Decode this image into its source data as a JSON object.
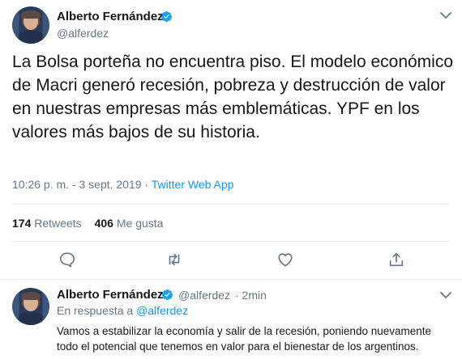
{
  "main_tweet": {
    "author_name": "Alberto Fernández",
    "author_handle": "@alferdez",
    "text": "La Bolsa porteña no encuentra piso. El modelo económico de Macri generó recesión, pobreza y destrucción de valor en nuestras empresas más emblemáticas. YPF en los valores más bajos de su historia.",
    "timestamp": "10:26 p. m. - 3 sept. 2019",
    "separator": " · ",
    "source": "Twitter Web App",
    "retweets_count": "174",
    "retweets_label": "Retweets",
    "likes_count": "406",
    "likes_label": "Me gusta"
  },
  "reply_tweet": {
    "author_name": "Alberto Fernández",
    "author_handle": "@alferdez",
    "time_ago": "· 2min",
    "in_reply_prefix": "En respuesta a",
    "in_reply_handle": "@alferdez",
    "text": "Vamos a estabilizar la economía y salir de la recesión, poniendo nuevamente todo el potencial que tenemos en valor para el bienestar de los argentinos."
  },
  "colors": {
    "accent": "#1b95e0",
    "verified": "#1da1f2",
    "secondary_text": "#657786",
    "divider": "#e6ecf0"
  },
  "icons": [
    "verified-badge-icon",
    "chevron-down-icon",
    "reply-icon",
    "retweet-icon",
    "like-icon",
    "share-icon"
  ]
}
